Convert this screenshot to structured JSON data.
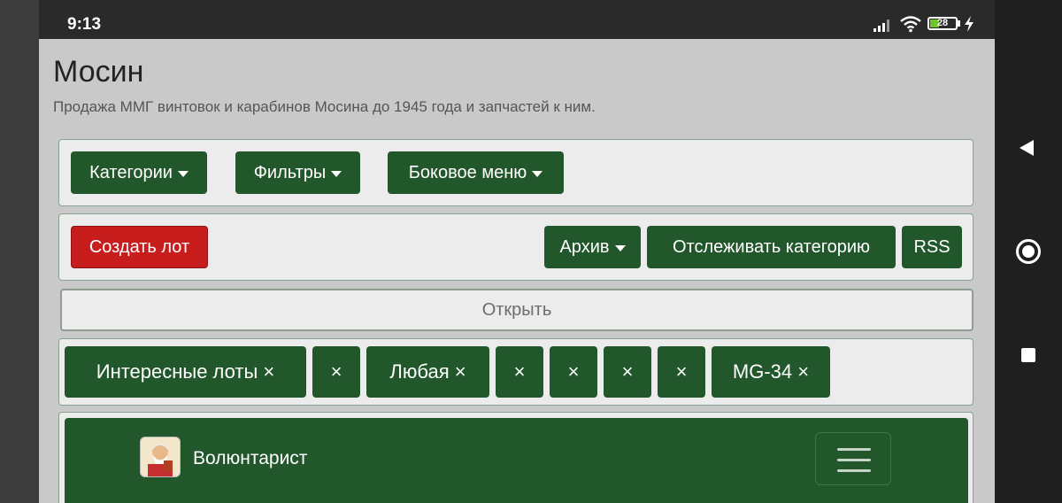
{
  "status_bar": {
    "time": "9:13",
    "battery_level": "28",
    "icons": [
      "signal-icon",
      "wifi-icon",
      "battery-icon",
      "charging-bolt-icon"
    ]
  },
  "page": {
    "title": "Мосин",
    "subtitle": "Продажа ММГ винтовок и карабинов Мосина до 1945 года и запчастей к ним."
  },
  "menu_row": {
    "categories": "Категории",
    "filters": "Фильтры",
    "side_menu": "Боковое меню"
  },
  "actions_row": {
    "create_lot": "Создать лот",
    "archive": "Архив",
    "follow_category": "Отслеживать категорию",
    "rss": "RSS"
  },
  "open_bar": {
    "label": "Открыть"
  },
  "tags": [
    "Интересные лоты ×",
    "×",
    "Любая ×",
    "×",
    "×",
    "×",
    "×",
    "MG-34 ×"
  ],
  "navbar": {
    "brand": "Волюнтарист",
    "menu_icon": "hamburger-menu-icon"
  },
  "colors": {
    "primary_green": "#22572b",
    "danger_red": "#c81d1d",
    "panel_bg": "#ececec",
    "page_bg": "#c9c9c9"
  }
}
